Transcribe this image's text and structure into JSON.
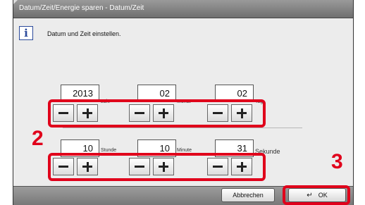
{
  "window": {
    "title": "Datum/Zeit/Energie sparen - Datum/Zeit"
  },
  "info": {
    "icon": "info-icon",
    "text": "Datum und Zeit einstellen."
  },
  "date": {
    "year": {
      "value": "2013",
      "unit": "Jahr"
    },
    "month": {
      "value": "02",
      "unit": "Monat"
    },
    "day": {
      "value": "02",
      "unit": "Tag"
    }
  },
  "time": {
    "hour": {
      "value": "10",
      "unit": "Stunde"
    },
    "minute": {
      "value": "10",
      "unit": "Minute"
    },
    "second": {
      "value": "31",
      "unit": "Sekunde"
    }
  },
  "callouts": {
    "step2": "2",
    "step3": "3"
  },
  "footer": {
    "cancel_label": "Abbrechen",
    "ok_label": "OK",
    "ok_icon": "enter-icon"
  },
  "colors": {
    "highlight": "#e0001b",
    "accent": "#2b4a9b"
  }
}
